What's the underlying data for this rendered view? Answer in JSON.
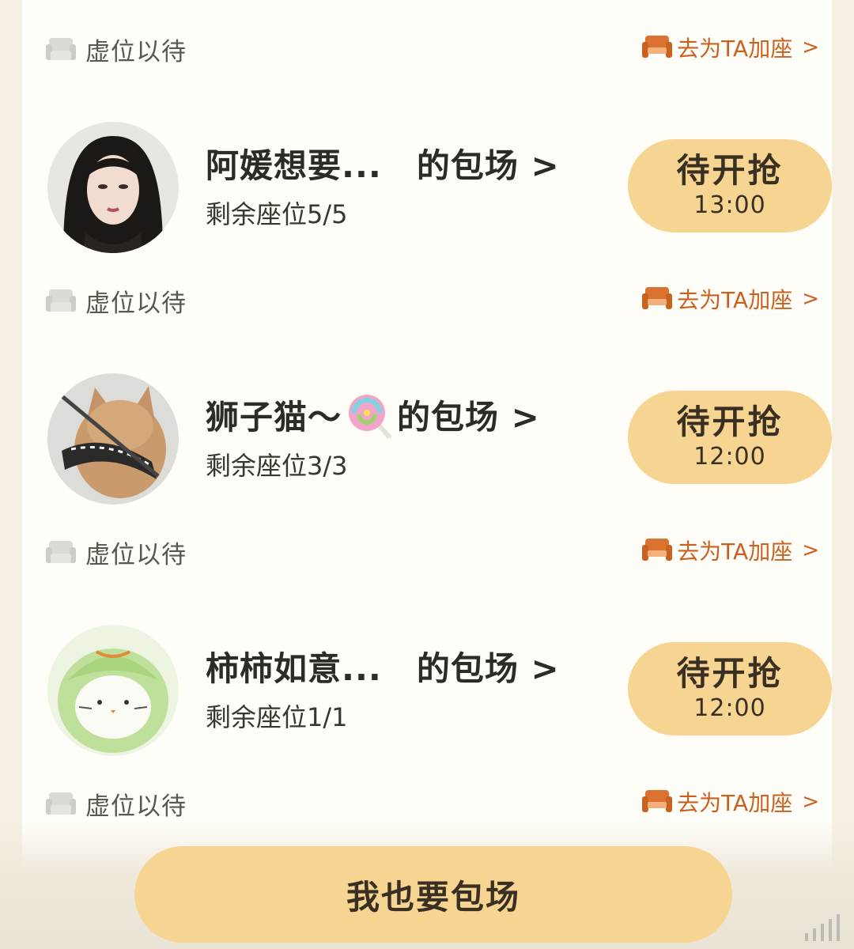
{
  "seat_rows": [
    {
      "left_label": "虚位以待",
      "right_label": "去为TA加座",
      "chevron": ">"
    },
    {
      "left_label": "虚位以待",
      "right_label": "去为TA加座",
      "chevron": ">"
    },
    {
      "left_label": "虚位以待",
      "right_label": "去为TA加座",
      "chevron": ">"
    },
    {
      "left_label": "虚位以待",
      "right_label": "去为TA加座",
      "chevron": ">"
    }
  ],
  "entries": [
    {
      "name": "阿媛想要...",
      "suffix": "的包场 >",
      "seats": "剩余座位5/5",
      "button_title": "待开抢",
      "button_time": "13:00",
      "avatar": "woman-portrait"
    },
    {
      "name": "狮子猫～",
      "emoji": "lollipop-icon",
      "suffix": "的包场 >",
      "seats": "剩余座位3/3",
      "button_title": "待开抢",
      "button_time": "12:00",
      "avatar": "cat-with-bandana"
    },
    {
      "name": "柿柿如意...",
      "suffix": "的包场 >",
      "seats": "剩余座位1/1",
      "button_title": "待开抢",
      "button_time": "12:00",
      "avatar": "green-cartoon-character"
    }
  ],
  "bottom": {
    "main_button": "我也要包场"
  },
  "colors": {
    "accent": "#c9611f",
    "button": "#f6d593",
    "background": "#fffdf8"
  }
}
